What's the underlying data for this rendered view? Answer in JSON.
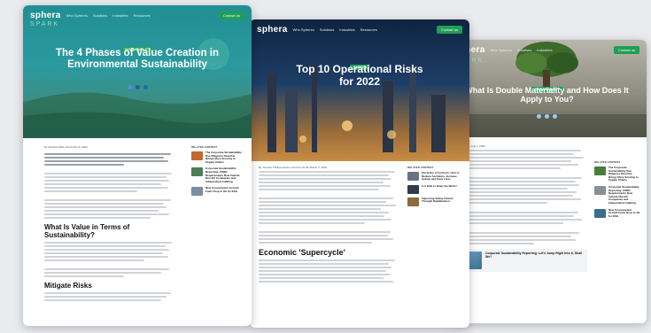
{
  "brand": {
    "name": "sphera",
    "sub": "SPARK",
    "nav_links": [
      "Who Spheres",
      "Solutions",
      "Industries",
      "Resources"
    ],
    "cta": "Contact us",
    "accent": "#1f9e55"
  },
  "cards": [
    {
      "pill": "SUSTAINABILITY",
      "title": "The 4 Phases of Value Creation in Environmental Sustainability",
      "byline": "By Michelle Miller  December 8, 2023",
      "h2a": "What Is Value in Terms of Sustainability?",
      "h2b": "Mitigate Risks",
      "sidebar_title": "RELATED CONTENT",
      "sidebar": [
        "The Corporate Sustainability Due Diligence Directive Brings More Scrutiny to Supply Chains",
        "Corporate Sustainability Reporting: CSRD Requirements Now Include Non-EU Companies and Independent Auditing",
        "New Consumption Growth Fuels Drop in Oil for ESG"
      ]
    },
    {
      "pill": "SAFETY",
      "title": "Top 10 Operational Risks for 2022",
      "byline": "By Jennifer Phillips-Hudson  and Ana Smith  March 3, 2022",
      "h2a": "Economic 'Supercycle'",
      "sidebar_title": "RELATED CONTENT",
      "sidebar": [
        "Hierarchy of Controls: How to Reduce Accidents, Increase Uptime and Save Lives",
        "Is it Safe to Enter the Work?",
        "Improving Safety Culture Through Digitalization"
      ]
    },
    {
      "pill": "SUSTAINABILITY",
      "title": "What Is Double Materiality and How Does It Apply to You?",
      "byline": "By Sam Allen  July 1, 2023",
      "sidebar_title": "RELATED CONTENT",
      "sidebar": [
        "The Corporate Sustainability Due Diligence Directive Brings More Scrutiny to Supply Chains",
        "Corporate Sustainability Reporting: CSRD Requirements Now Include Non-EU Companies and Independent Auditing",
        "New Consumption Growth Fuels Drop in Oil for ESG"
      ],
      "promo": "Corporate Sustainability Reporting: Let's Jump Right Into It, Shall We?"
    }
  ]
}
